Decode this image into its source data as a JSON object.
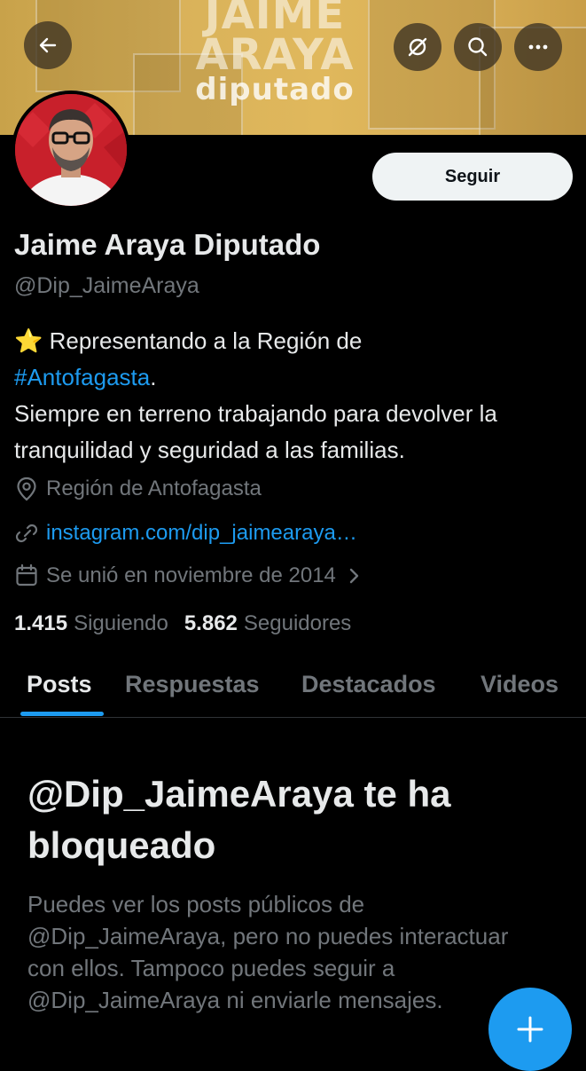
{
  "banner": {
    "line1": "JAIME",
    "line2": "ARAYA",
    "line3": "diputado"
  },
  "topbar": {
    "back_icon": "arrow-left-icon",
    "grok_icon": "slashed-circle-icon",
    "search_icon": "search-icon",
    "more_icon": "more-dots-icon"
  },
  "profile": {
    "name": "Jaime Araya Diputado",
    "handle": "@Dip_JaimeAraya",
    "follow_label": "Seguir",
    "bio_emoji": "⭐",
    "bio_line1": " Representando a la Región de",
    "bio_hashtag": "#Antofagasta",
    "bio_period": ".",
    "bio_line3": "Siempre en terreno trabajando para devolver la tranquilidad y seguridad a las familias.",
    "location": "Región de Antofagasta",
    "website": "instagram.com/dip_jaimearaya…",
    "joined": "Se unió en noviembre de 2014",
    "following_count": "1.415",
    "following_label": "Siguiendo",
    "followers_count": "5.862",
    "followers_label": "Seguidores"
  },
  "tabs": [
    "Posts",
    "Respuestas",
    "Destacados",
    "Videos"
  ],
  "blocked": {
    "title": "@Dip_JaimeAraya te ha bloqueado",
    "body": "Puedes ver los posts públicos de @Dip_JaimeAraya, pero no puedes interactuar con ellos. Tampoco puedes seguir a @Dip_JaimeAraya ni enviarle mensajes."
  },
  "fab": {
    "icon": "plus-icon"
  },
  "colors": {
    "accent": "#1d9bf0",
    "background": "#000000",
    "muted": "#71767b"
  }
}
